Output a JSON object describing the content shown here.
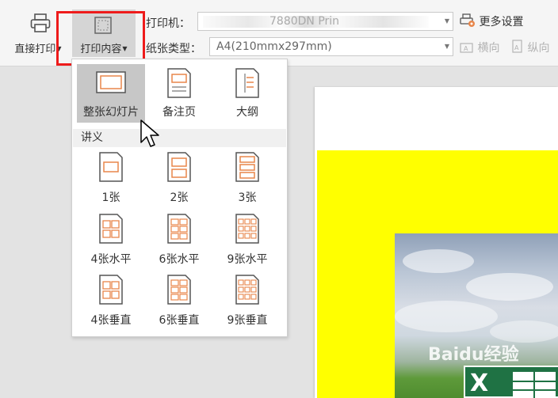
{
  "toolbar": {
    "direct_print": "直接打印",
    "print_content": "打印内容",
    "printer_label": "打印机：",
    "printer_value": "7880DN Prin",
    "paper_label": "纸张类型：",
    "paper_value": "A4(210mmx297mm)",
    "more_settings": "更多设置",
    "landscape": "横向",
    "portrait": "纵向"
  },
  "dropdown": {
    "top_options": [
      {
        "label": "整张幻灯片",
        "icon": "full-slide-icon",
        "selected": true
      },
      {
        "label": "备注页",
        "icon": "notes-page-icon",
        "selected": false
      },
      {
        "label": "大纲",
        "icon": "outline-icon",
        "selected": false
      }
    ],
    "handouts_header": "讲义",
    "handout_options": [
      {
        "label": "1张",
        "icon": "handout-1-icon"
      },
      {
        "label": "2张",
        "icon": "handout-2-icon"
      },
      {
        "label": "3张",
        "icon": "handout-3-icon"
      },
      {
        "label": "4张水平",
        "icon": "handout-4-horizontal-icon"
      },
      {
        "label": "6张水平",
        "icon": "handout-6-horizontal-icon"
      },
      {
        "label": "9张水平",
        "icon": "handout-9-horizontal-icon"
      },
      {
        "label": "4张垂直",
        "icon": "handout-4-vertical-icon"
      },
      {
        "label": "6张垂直",
        "icon": "handout-6-vertical-icon"
      },
      {
        "label": "9张垂直",
        "icon": "handout-9-vertical-icon"
      }
    ]
  },
  "preview": {
    "watermark": "Baidu经验",
    "slide_colors": {
      "background": "#ffff00"
    }
  },
  "colors": {
    "highlight_box": "#ee1b1b",
    "icon_accent": "#e8864a"
  }
}
